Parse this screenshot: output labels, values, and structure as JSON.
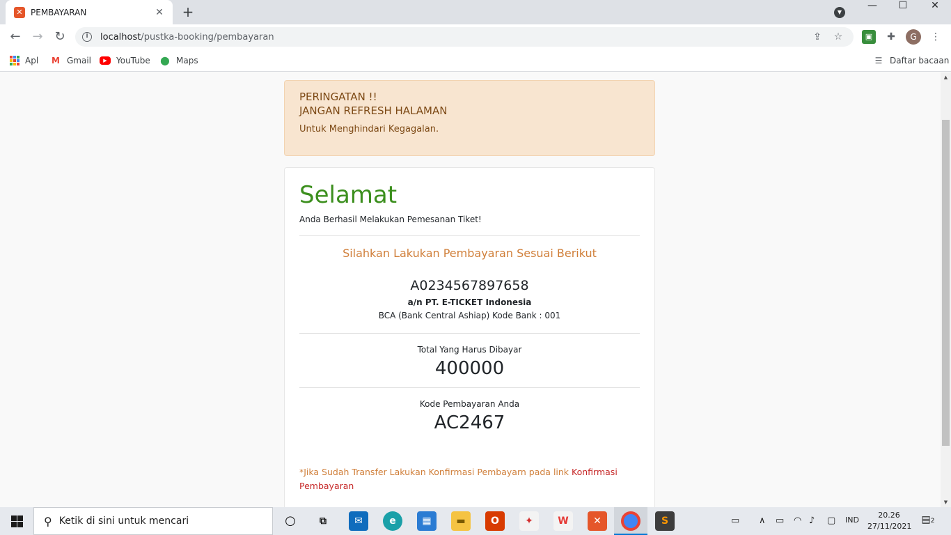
{
  "browser": {
    "tab_title": "PEMBAYARAN",
    "url_host": "localhost",
    "url_path": "/pustka-booking/pembayaran",
    "profile_initial": "G",
    "bookmarks": [
      {
        "label": "Apl",
        "icon": "apps-grid-icon"
      },
      {
        "label": "Gmail",
        "icon": "gmail-icon"
      },
      {
        "label": "YouTube",
        "icon": "youtube-icon"
      },
      {
        "label": "Maps",
        "icon": "maps-icon"
      }
    ],
    "reading_list": "Daftar bacaan"
  },
  "alert": {
    "line1": "PERINGATAN !!",
    "line2": "JANGAN REFRESH HALAMAN",
    "body": "Untuk Menghindari Kegagalan."
  },
  "card": {
    "title": "Selamat",
    "subtitle": "Anda Berhasil Melakukan Pemesanan Tiket!",
    "payment_heading": "Silahkan Lakukan Pembayaran Sesuai Berikut",
    "account_number": "A0234567897658",
    "account_name": "a/n PT. E-TICKET Indonesia",
    "bank_info": "BCA (Bank Central Ashiap) Kode Bank : 001",
    "total_label": "Total Yang Harus Dibayar",
    "total_value": "400000",
    "code_label": "Kode Pembayaran Anda",
    "code_value": "AC2467",
    "footnote_text": "*Jika Sudah Transfer Lakukan Konfirmasi Pembayarn pada link ",
    "footnote_link": "Konfirmasi Pembayaran"
  },
  "taskbar": {
    "search_placeholder": "Ketik di sini untuk mencari",
    "language": "IND",
    "time": "20.26",
    "date": "27/11/2021",
    "notifications": "2"
  },
  "colors": {
    "alert_bg": "#f8e5d0",
    "alert_text": "#7d4a16",
    "title_green": "#3c8f1e",
    "accent_orange": "#d07f3a",
    "link_red": "#c62828"
  }
}
